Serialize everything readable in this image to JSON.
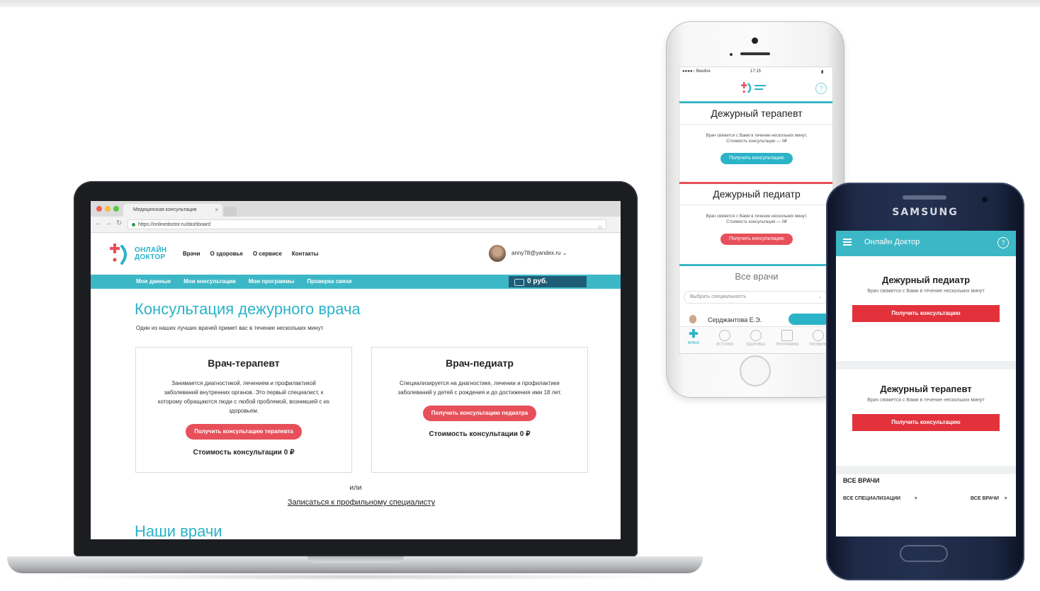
{
  "laptop": {
    "tab_title": "Медицинская консультация",
    "url": "https://onlinedoctor.ru/dashboard",
    "logo_line1": "ОНЛАЙН",
    "logo_line2": "ДОКТОР",
    "nav": [
      "Врачи",
      "О здоровье",
      "О сервисе",
      "Контакты"
    ],
    "user_email": "anny78@yandex.ru",
    "subnav": [
      "Мои данные",
      "Мои консультации",
      "Мои программы",
      "Проверка связи"
    ],
    "balance": "0 руб.",
    "title": "Консультация дежурного врача",
    "subtitle": "Один из наших лучших врачей примет вас в течение нескольких минут",
    "cards": [
      {
        "title": "Врач-терапевт",
        "desc": "Занимается диагностикой, лечением и профилактикой заболеваний внутренних органов. Это первый специалист, к которому обращаются люди с любой проблемой, возникшей с их здоровьем.",
        "button": "Получить консультацию терапевта",
        "price": "Стоимость консультации 0 ₽"
      },
      {
        "title": "Врач-педиатр",
        "desc": "Специализируется на диагностике, лечении и профилактике заболеваний у детей с рождения и до достижения ими 18 лет.",
        "button": "Получить консультацию педиатра",
        "price": "Стоимость консультации 0 ₽"
      }
    ],
    "or": "или",
    "specialist_link": "Записаться к профильному специалисту",
    "doctors_heading": "Наши врачи"
  },
  "iphone": {
    "status_carrier": "●●●●○ Beeline",
    "status_time": "17:15",
    "status_battery": "▮",
    "help": "?",
    "sections": [
      {
        "title": "Дежурный терапевт",
        "desc": "Врач свяжется с Вами в течение нескольких минут. Стоимость консультации — 0₽",
        "button": "Получить консультацию",
        "button_color": "#2bb3c8"
      },
      {
        "title": "Дежурный педиатр",
        "desc": "Врач свяжется с Вами в течение нескольких минут. Стоимость консультации — 0₽",
        "button": "Получить консультацию",
        "button_color": "#e7505a"
      }
    ],
    "all_doctors": "Все врачи",
    "select_placeholder": "Выбрать специальность",
    "doctor_name": "Серджантова Е.Э.",
    "tabs": [
      "ВРАЧИ",
      "ИСТОРИЯ",
      "ЗДОРОВЬЕ",
      "ПРОГРАММЫ",
      "ПРОФИЛЬ"
    ]
  },
  "samsung": {
    "brand": "SAMSUNG",
    "app_title": "Онлайн Доктор",
    "help": "?",
    "cards": [
      {
        "title": "Дежурный педиатр",
        "desc": "Врач свяжется с Вами в течение нескольких минут",
        "button": "Получить консультацию"
      },
      {
        "title": "Дежурный терапевт",
        "desc": "Врач свяжется с Вами в течение нескольких минут",
        "button": "Получить консультацию"
      }
    ],
    "all_doctors": "ВСЕ ВРАЧИ",
    "filter_specialty": "ВСЕ СПЕЦИАЛИЗАЦИИ",
    "filter_doctors": "ВСЕ ВРАЧИ"
  },
  "colors": {
    "brand_teal": "#2ab3c8",
    "accent_red": "#e7505a",
    "dark_blue": "#1f5d77"
  }
}
